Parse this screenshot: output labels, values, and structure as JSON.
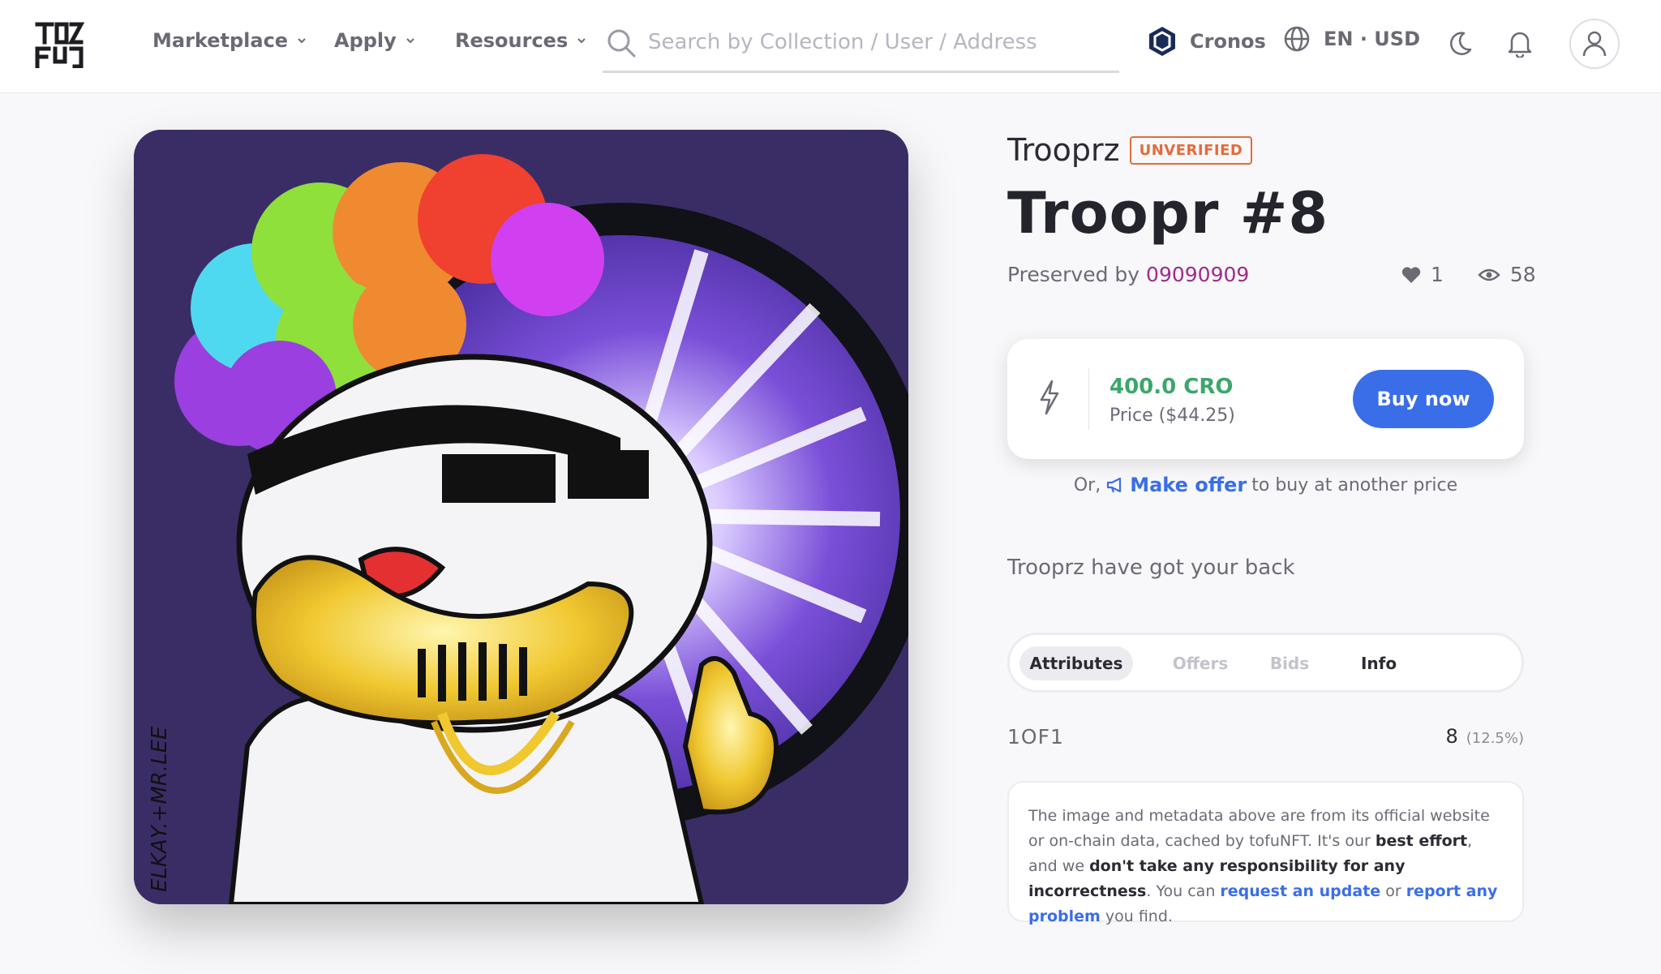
{
  "header": {
    "logo_text": "TOFU",
    "nav": [
      {
        "label": "Marketplace"
      },
      {
        "label": "Apply"
      },
      {
        "label": "Resources"
      }
    ],
    "search_placeholder": "Search by Collection / User / Address",
    "chain_label": "Cronos",
    "language_label": "EN · USD",
    "icons": [
      "tofu-logo-icon",
      "search-icon",
      "cronos-icon",
      "globe-icon",
      "moon-icon",
      "bell-icon",
      "user-icon"
    ]
  },
  "artwork": {
    "signature": "ELKAY.+MR.LEE"
  },
  "item": {
    "collection": "Trooprz",
    "verified_badge": "UNVERIFIED",
    "title": "Troopr #8",
    "owner_prefix": "Preserved by",
    "owner": "09090909",
    "likes": "1",
    "views": "58",
    "price_cro": "400.0 CRO",
    "price_usd": "Price ($44.25)",
    "buy_label": "Buy now",
    "offer_prefix": "Or,",
    "offer_link": "Make offer",
    "offer_suffix": "to buy at another price",
    "description": "Trooprz have got your back"
  },
  "tabs": [
    {
      "label": "Attributes",
      "active": true
    },
    {
      "label": "Offers",
      "active": false
    },
    {
      "label": "Bids",
      "active": false
    },
    {
      "label": "Info",
      "active": false
    }
  ],
  "attributes": [
    {
      "name": "1OF1",
      "count": "8",
      "percent": "(12.5%)"
    }
  ],
  "disclaimer": {
    "t1": "The image and metadata above are from its official website or on-chain data, cached by tofuNFT. It's our ",
    "b1": "best effort",
    "t2": ", and we ",
    "b2": "don't take any responsibility for any incorrectness",
    "t3": ". You can ",
    "l1": "request an update",
    "t4": " or ",
    "l2": "report any problem",
    "t5": " you find."
  },
  "colors": {
    "accent_blue": "#3a6ee8",
    "price_green": "#3ca66b",
    "owner_purple": "#a02a8c",
    "badge_orange": "#e36b3b",
    "artwork_bg": "#3a2d66"
  }
}
